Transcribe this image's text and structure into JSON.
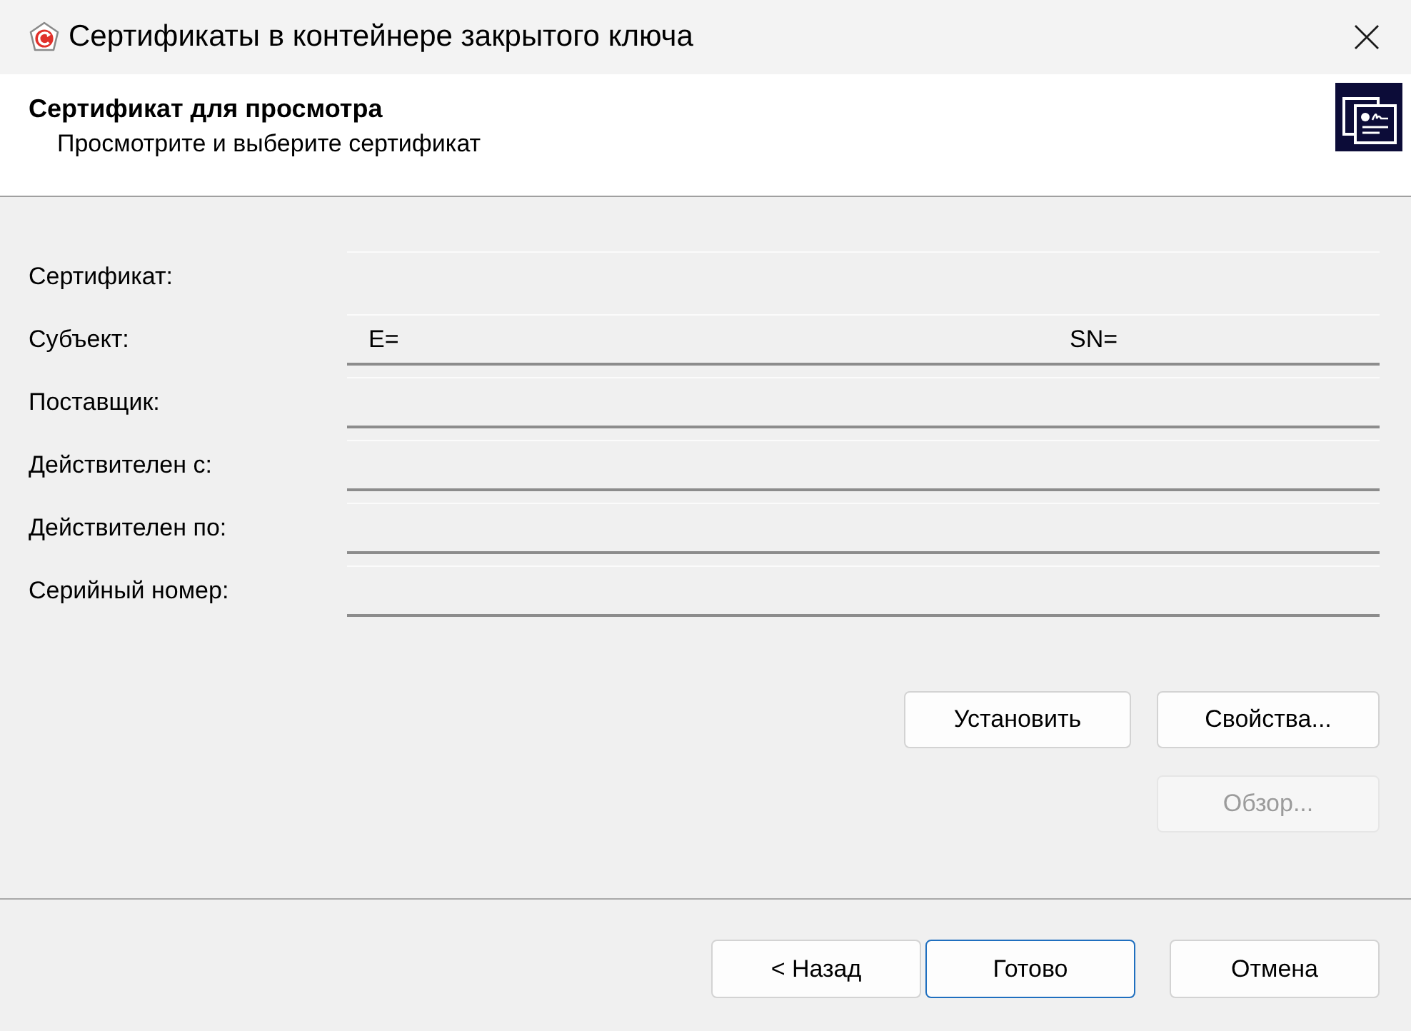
{
  "window": {
    "title": "Сертификаты в контейнере закрытого ключа"
  },
  "header": {
    "title": "Сертификат для просмотра",
    "subtitle": "Просмотрите и выберите сертификат"
  },
  "fields": [
    {
      "label": "Сертификат:",
      "kind": "plain"
    },
    {
      "label": "Субъект:",
      "kind": "pair",
      "values": [
        "E=",
        "SN="
      ]
    },
    {
      "label": "Поставщик:",
      "kind": "wide"
    },
    {
      "label": "Действителен с:",
      "kind": "split"
    },
    {
      "label": "Действителен по:",
      "kind": "split"
    },
    {
      "label": "Серийный номер:",
      "kind": "split"
    }
  ],
  "action_rows": [
    {
      "buttons": [
        {
          "label": "Установить",
          "disabled": false
        },
        {
          "label": "Свойства...",
          "disabled": false
        }
      ]
    },
    {
      "buttons": [
        {
          "label": "Обзор...",
          "disabled": true
        }
      ]
    }
  ],
  "wizard_buttons": [
    {
      "label": "< Назад",
      "default": false
    },
    {
      "label": "Готово",
      "default": true
    },
    {
      "label": "Отмена",
      "default": false
    }
  ]
}
